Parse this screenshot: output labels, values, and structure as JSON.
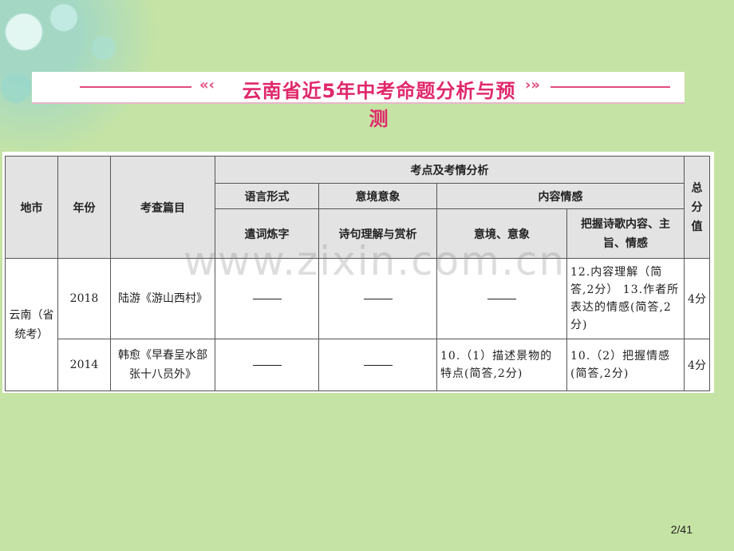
{
  "title": "云南省近5年中考命题分析与预测",
  "table": {
    "headers": {
      "city": "地市",
      "year": "年份",
      "article": "考查篇目",
      "analysis": "考点及考情分析",
      "total": "总分值",
      "language_form": "语言形式",
      "imagery": "意境意象",
      "content": "内容情感",
      "word_choice": "遣词炼字",
      "line_appreciation": "诗句理解与赏析",
      "mood_image": "意境、意象",
      "theme_emotion": "把握诗歌内容、主旨、情感"
    },
    "region": "云南（省统考）",
    "rows": [
      {
        "year": "2018",
        "article": "陆游《游山西村》",
        "mood_image": "",
        "theme_emotion": "12.内容理解（简答,2分） 13.作者所表达的情感(简答,2分)",
        "total": "4分"
      },
      {
        "year": "2014",
        "article": "韩愈《早春呈水部张十八员外》",
        "mood_image": "10.（1）描述景物的特点(简答,2分)",
        "theme_emotion": "10.（2）把握情感(简答,2分)",
        "total": "4分"
      }
    ]
  },
  "watermark": "www.zixin.com.cn",
  "page_number": "2/41"
}
